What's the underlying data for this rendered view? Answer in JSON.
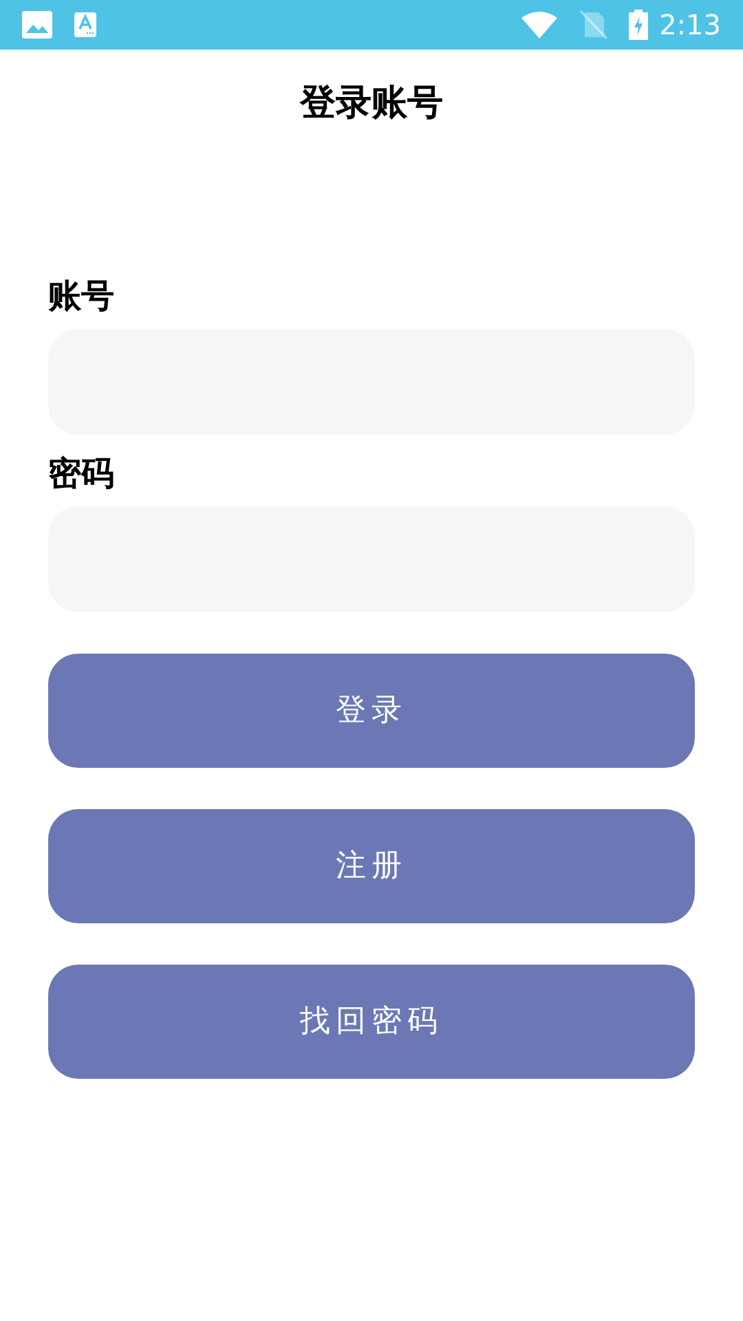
{
  "status_bar": {
    "time": "2:13"
  },
  "title": "登录账号",
  "fields": [
    {
      "label": "账号"
    },
    {
      "label": "密码"
    }
  ],
  "buttons": [
    "登录",
    "注册",
    "找回密码"
  ]
}
